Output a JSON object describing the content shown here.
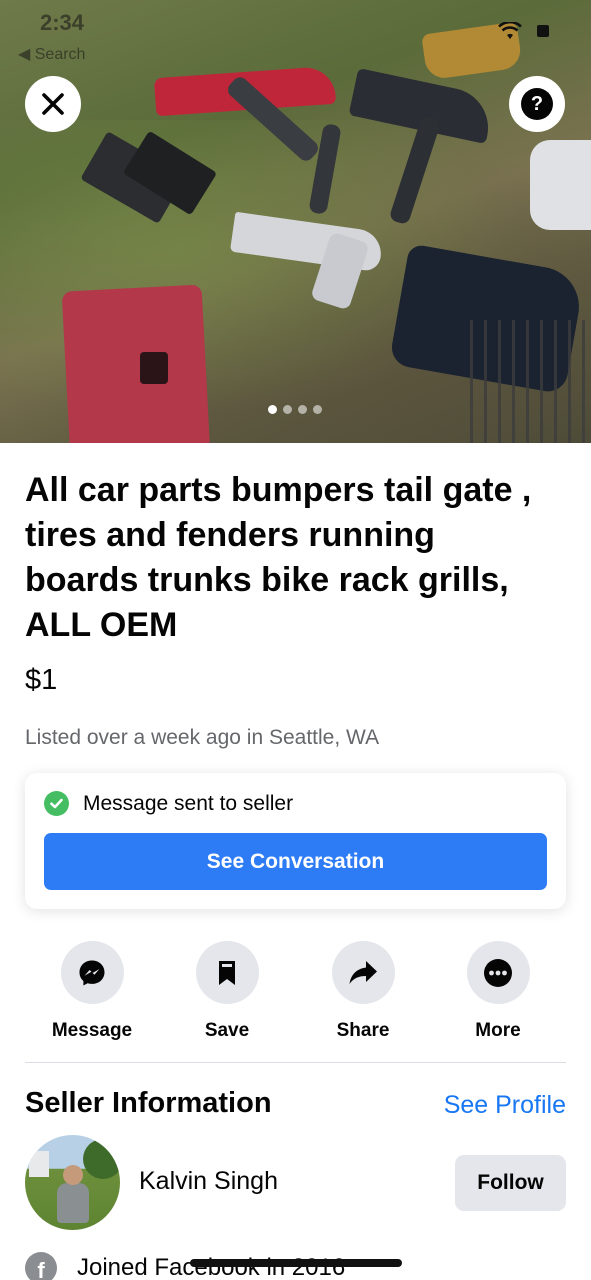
{
  "status_bar": {
    "time": "2:34",
    "back_label": "◀ Search"
  },
  "hero": {
    "image_count": 4,
    "active_index": 0,
    "close_icon": "close-icon",
    "help_label": "?"
  },
  "listing": {
    "title": "All car parts bumpers tail gate , tires and fenders running boards trunks bike rack grills, ALL OEM",
    "price": "$1",
    "listed": "Listed over a week ago in Seattle, WA"
  },
  "message_card": {
    "status_text": "Message sent to seller",
    "button_label": "See Conversation",
    "button_color": "#2d7cf6",
    "check_color": "#45bd62"
  },
  "actions": [
    {
      "label": "Message",
      "icon": "messenger-icon"
    },
    {
      "label": "Save",
      "icon": "bookmark-icon"
    },
    {
      "label": "Share",
      "icon": "share-arrow-icon"
    },
    {
      "label": "More",
      "icon": "more-dots-icon"
    }
  ],
  "seller": {
    "section_title": "Seller Information",
    "see_profile": "See Profile",
    "name": "Kalvin Singh",
    "follow_label": "Follow",
    "joined": "Joined Facebook in 2016",
    "accent_color": "#1877f2"
  }
}
